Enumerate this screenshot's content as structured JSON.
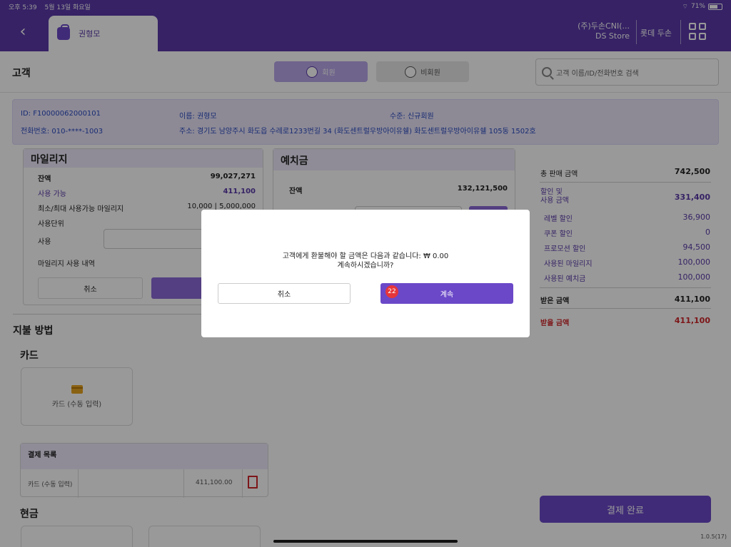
{
  "status": {
    "time": "오후 5:39",
    "date": "5월 13일 화요일",
    "battery": "71%",
    "battery_level": 0.71
  },
  "header": {
    "tab_label": "권형모",
    "store_line1": "(주)두손CNI(...",
    "store_line2": "DS Store",
    "user": "롯데 두손"
  },
  "customer": {
    "title": "고객",
    "member_label": "회원",
    "guest_label": "비회원",
    "search_placeholder": "고객 이름/ID/전화번호 검색"
  },
  "info": {
    "id": "ID: F10000062000101",
    "name": "이름: 권형모",
    "level": "수준: 신규회원",
    "phone": "전화번호: 010-****-1003",
    "address": "주소: 경기도 남양주시 화도읍 수레로1233번길 34  (화도센트럴우방아이유쉘) 화도센트럴우방아이유쉘 105동 1502호"
  },
  "mileage": {
    "title": "마일리지",
    "balance_label": "잔액",
    "balance": "99,027,271",
    "usable_label": "사용 가능",
    "usable": "411,100",
    "minmax_label": "최소/최대 사용가능 마일리지",
    "minmax": "10,000 | 5,000,000",
    "unit_label": "사용단위",
    "use_label": "사용",
    "history_label": "마일리지 사용 내역",
    "cancel": "취소"
  },
  "deposit": {
    "title": "예치금",
    "balance_label": "잔액",
    "balance": "132,121,500"
  },
  "payment": {
    "title": "지불 방법",
    "card_section": "카드",
    "card_tile": "카드 (수동 입력)",
    "list_title": "결제 목록",
    "list_rows": [
      {
        "method": "카드 (수동 입력)",
        "amount": "411,100.00"
      }
    ],
    "cash_section": "현금"
  },
  "summary": {
    "total_label": "총 판매 금액",
    "total": "742,500",
    "discount_label_1": "할인 및",
    "discount_label_2": "사용 금액",
    "discount": "331,400",
    "items": [
      {
        "label": "레벨 할인",
        "value": "36,900"
      },
      {
        "label": "쿠폰 할인",
        "value": "0"
      },
      {
        "label": "프로모션 할인",
        "value": "94,500"
      },
      {
        "label": "사용된 마일리지",
        "value": "100,000"
      },
      {
        "label": "사용된 예치금",
        "value": "100,000"
      }
    ],
    "received_label": "받은 금액",
    "received": "411,100",
    "due_label": "받을 금액",
    "due": "411,100",
    "complete": "결제 완료"
  },
  "modal": {
    "line1": "고객에게 환불해야 할 금액은 다음과 같습니다: ₩ 0.00",
    "line2": "계속하시겠습니까?",
    "cancel": "취소",
    "continue": "계속",
    "badge": "22"
  },
  "version": "1.0.5(17)",
  "colors": {
    "brand": "#5a3aa8",
    "accent": "#6b48c8",
    "due": "#d0262b"
  }
}
